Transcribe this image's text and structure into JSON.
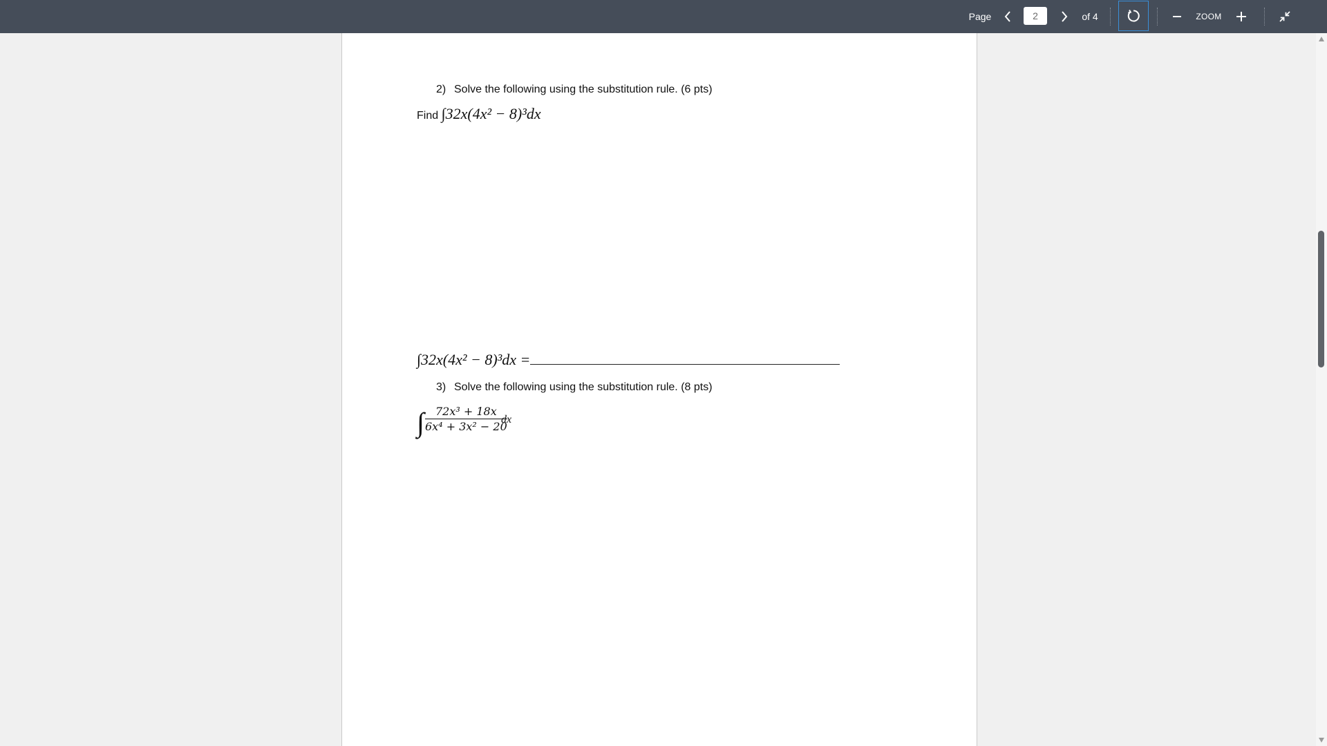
{
  "toolbar": {
    "page_label": "Page",
    "current_page": "2",
    "total_pages_label": "of 4",
    "zoom_label": "ZOOM"
  },
  "document": {
    "question2": {
      "number": "2)",
      "instruction": "Solve the following using the substitution rule. (6 pts)",
      "find_word": "Find",
      "integral": "32x(4x² − 8)³dx",
      "answer_expr": "32x(4x² − 8)³dx ="
    },
    "question3": {
      "number": "3)",
      "instruction": "Solve the following using the substitution rule. (8 pts)",
      "numerator": "72x³ + 18x",
      "denominator": "6x⁴ + 3x² − 20",
      "dx": "dx"
    }
  },
  "colors": {
    "toolbar_bg": "#454d59",
    "viewer_bg": "#f0f0f0",
    "focus_outline": "#3a8fd9"
  },
  "icons": [
    "chevron-left-icon",
    "chevron-right-icon",
    "refresh-icon",
    "minus-icon",
    "plus-icon",
    "exit-fullscreen-icon",
    "scroll-up-icon",
    "scroll-down-icon"
  ]
}
